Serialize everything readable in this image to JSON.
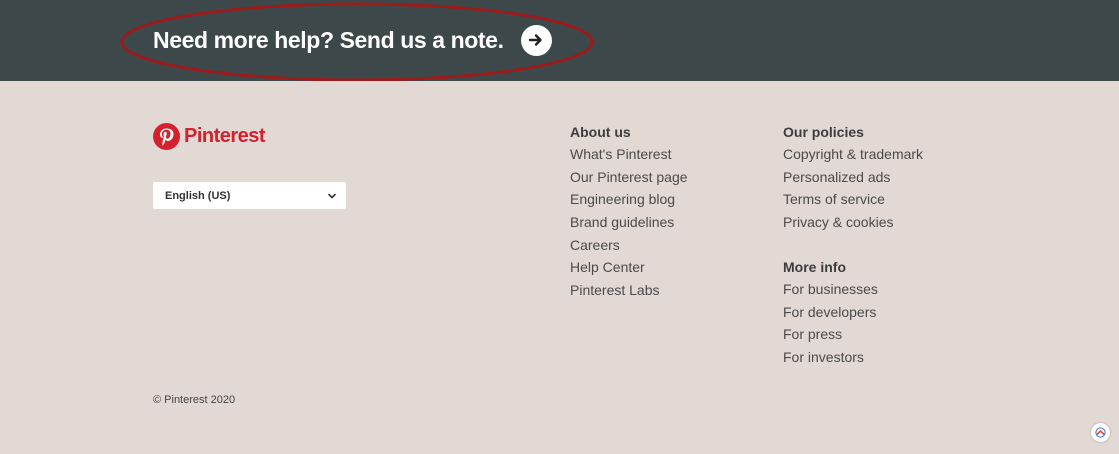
{
  "colors": {
    "banner_bg": "#3d484b",
    "page_bg": "#e2d9d5",
    "brand_red": "#d3212e",
    "annotation_red": "#9b1b1b"
  },
  "help_banner": {
    "text": "Need more help? Send us a note.",
    "icon": "arrow-right-icon"
  },
  "brand": {
    "name": "Pinterest",
    "icon": "pinterest-logo-icon"
  },
  "language_select": {
    "selected": "English (US)",
    "icon": "chevron-down-icon"
  },
  "about_us": {
    "heading": "About us",
    "links": [
      "What's Pinterest",
      "Our Pinterest page",
      "Engineering blog",
      "Brand guidelines",
      "Careers",
      "Help Center",
      "Pinterest Labs"
    ]
  },
  "our_policies": {
    "heading": "Our policies",
    "links": [
      "Copyright & trademark",
      "Personalized ads",
      "Terms of service",
      "Privacy & cookies"
    ]
  },
  "more_info": {
    "heading": "More info",
    "links": [
      "For businesses",
      "For developers",
      "For press",
      "For investors"
    ]
  },
  "copyright": "© Pinterest 2020",
  "floating_button": {
    "icon": "chevron-up-icon"
  }
}
